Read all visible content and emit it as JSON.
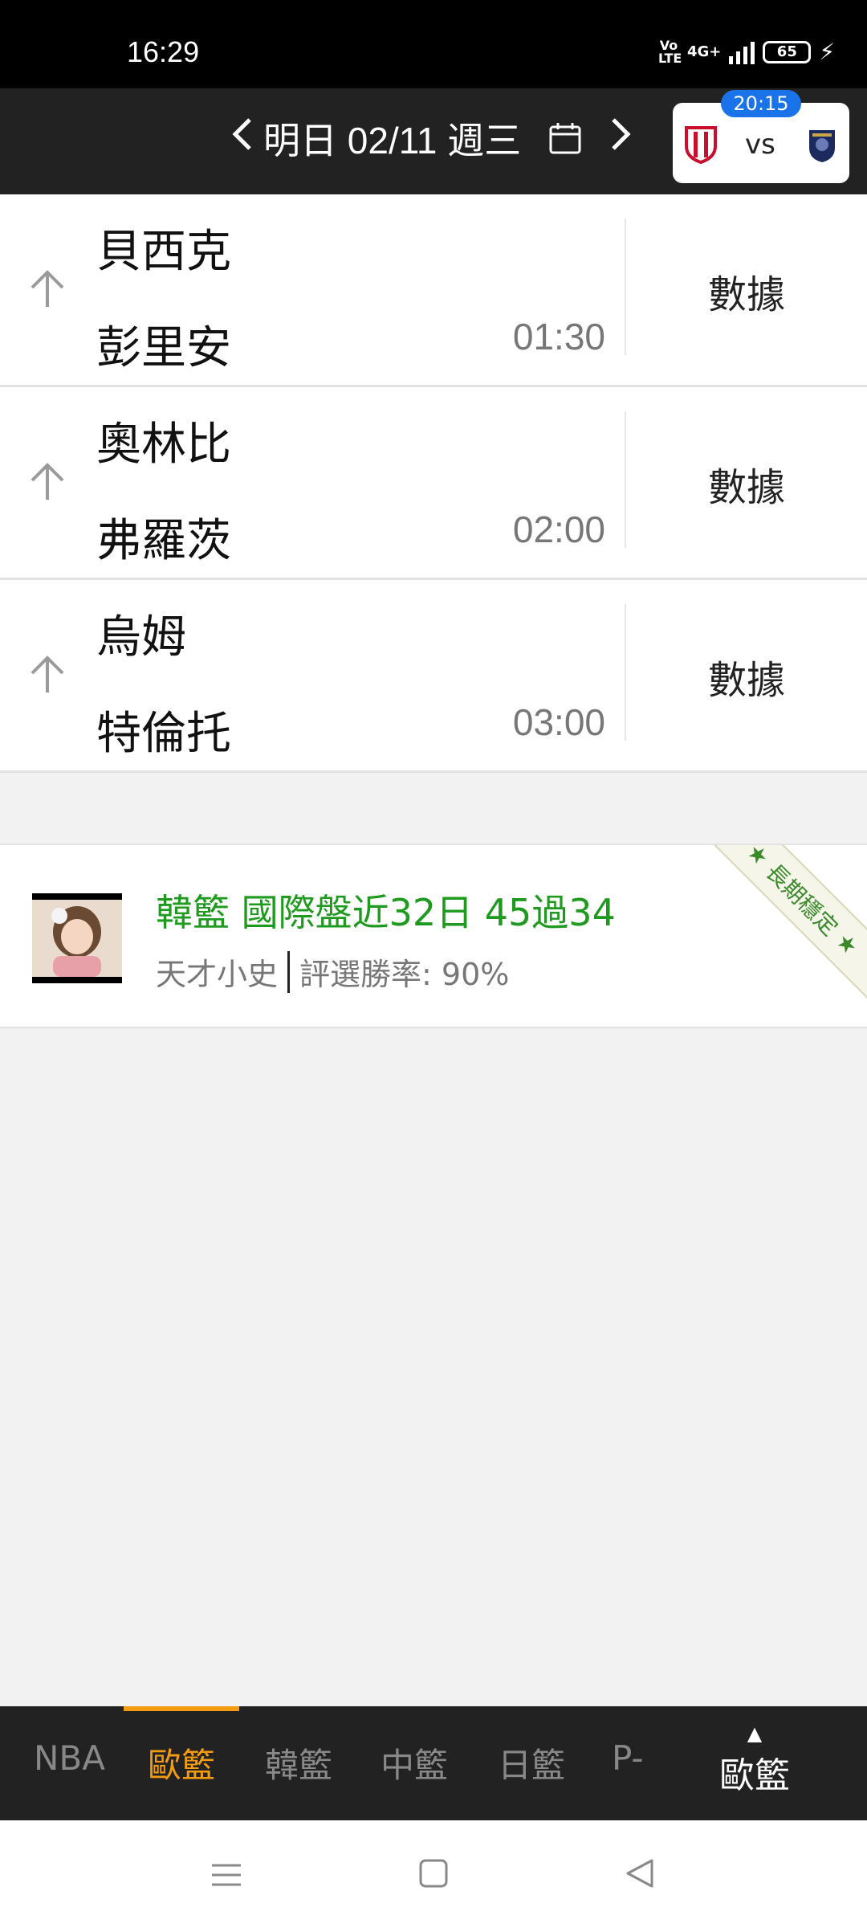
{
  "status_bar": {
    "time": "16:29",
    "volte": "Vo LTE",
    "network": "4G+",
    "battery": "65",
    "icons": [
      "volte-icon",
      "signal-icon",
      "battery-icon",
      "charging-icon"
    ]
  },
  "header": {
    "date_label": "明日 02/11 週三",
    "prev_icon": "chevron-left-icon",
    "next_icon": "chevron-right-icon",
    "calendar_icon": "calendar-icon",
    "live_match": {
      "time": "20:15",
      "vs_label": "vs",
      "home_logo": "red-shield-logo",
      "away_logo": "navy-crest-logo",
      "time_badge_color": "#1a73e8"
    }
  },
  "matches": [
    {
      "home": "貝西克",
      "away": "彭里安",
      "time": "01:30",
      "data_label": "數據"
    },
    {
      "home": "奧林比",
      "away": "弗羅茨",
      "time": "02:00",
      "data_label": "數據"
    },
    {
      "home": "烏姆",
      "away": "特倫托",
      "time": "03:00",
      "data_label": "數據"
    }
  ],
  "expert": {
    "title": "韓籃 國際盤近32日 45過34",
    "name": "天才小史",
    "win_rate": "評選勝率: 90%",
    "badge": "長期穩定",
    "badge_star": "★",
    "title_color": "#1e9a1e"
  },
  "bottom_tabs": {
    "items": [
      "NBA",
      "歐籃",
      "韓籃",
      "中籃",
      "日籃",
      "P-"
    ],
    "active_index": 1,
    "current_label": "歐籃",
    "current_icon": "triangle-up-icon",
    "active_color": "#f39c12"
  },
  "nav_bar": {
    "icons": [
      "menu-icon",
      "home-icon",
      "back-icon"
    ]
  }
}
